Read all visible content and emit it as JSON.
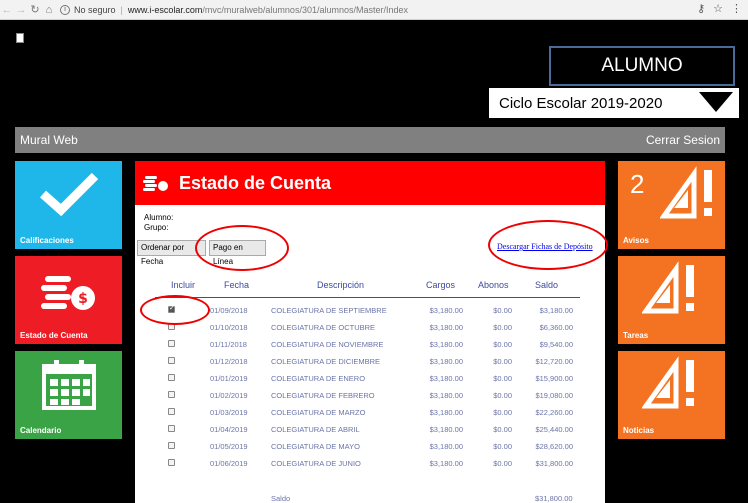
{
  "browser": {
    "security": "No seguro",
    "host": "www.i-escolar.com",
    "path": "/mvc/muralweb/alumnos/301/alumnos/Master/Index"
  },
  "header": {
    "role": "ALUMNO",
    "cycle": "Ciclo Escolar  2019-2020"
  },
  "topbar": {
    "app_name": "Mural Web",
    "logout": "Cerrar Sesion"
  },
  "tiles": {
    "calificaciones": "Calificaciones",
    "estado": "Estado de Cuenta",
    "calendario": "Calendario",
    "avisos": "Avisos",
    "avisos_count": "2",
    "tareas": "Tareas",
    "noticias": "Noticias"
  },
  "panel": {
    "title": "Estado de Cuenta",
    "alumno_label": "Alumno:",
    "grupo_label": "Grupo:",
    "btn_order": "Ordenar por Fecha",
    "btn_pay": "Pago en Línea",
    "download_link": "Descargar Fichas de Depósito",
    "columns": {
      "incluir": "Incluir",
      "fecha": "Fecha",
      "descripcion": "Descripción",
      "cargos": "Cargos",
      "abonos": "Abonos",
      "saldo": "Saldo"
    },
    "rows": [
      {
        "checked": true,
        "fecha": "01/09/2018",
        "desc": "COLEGIATURA DE SEPTIEMBRE",
        "cargo": "$3,180.00",
        "abono": "$0.00",
        "saldo": "$3,180.00"
      },
      {
        "checked": false,
        "fecha": "01/10/2018",
        "desc": "COLEGIATURA DE OCTUBRE",
        "cargo": "$3,180.00",
        "abono": "$0.00",
        "saldo": "$6,360.00"
      },
      {
        "checked": false,
        "fecha": "01/11/2018",
        "desc": "COLEGIATURA DE NOVIEMBRE",
        "cargo": "$3,180.00",
        "abono": "$0.00",
        "saldo": "$9,540.00"
      },
      {
        "checked": false,
        "fecha": "01/12/2018",
        "desc": "COLEGIATURA DE DICIEMBRE",
        "cargo": "$3,180.00",
        "abono": "$0.00",
        "saldo": "$12,720.00"
      },
      {
        "checked": false,
        "fecha": "01/01/2019",
        "desc": "COLEGIATURA DE ENERO",
        "cargo": "$3,180.00",
        "abono": "$0.00",
        "saldo": "$15,900.00"
      },
      {
        "checked": false,
        "fecha": "01/02/2019",
        "desc": "COLEGIATURA DE FEBRERO",
        "cargo": "$3,180.00",
        "abono": "$0.00",
        "saldo": "$19,080.00"
      },
      {
        "checked": false,
        "fecha": "01/03/2019",
        "desc": "COLEGIATURA DE MARZO",
        "cargo": "$3,180.00",
        "abono": "$0.00",
        "saldo": "$22,260.00"
      },
      {
        "checked": false,
        "fecha": "01/04/2019",
        "desc": "COLEGIATURA DE ABRIL",
        "cargo": "$3,180.00",
        "abono": "$0.00",
        "saldo": "$25,440.00"
      },
      {
        "checked": false,
        "fecha": "01/05/2019",
        "desc": "COLEGIATURA DE MAYO",
        "cargo": "$3,180.00",
        "abono": "$0.00",
        "saldo": "$28,620.00"
      },
      {
        "checked": false,
        "fecha": "01/06/2019",
        "desc": "COLEGIATURA DE JUNIO",
        "cargo": "$3,180.00",
        "abono": "$0.00",
        "saldo": "$31,800.00"
      }
    ],
    "saldo_label": "Saldo",
    "saldo_total": "$31,800.00"
  },
  "colors": {
    "red": "#ff0000",
    "orange": "#f47322",
    "blue": "#1fb7ea",
    "green": "#3aa346",
    "table_text": "#6b74a8"
  }
}
